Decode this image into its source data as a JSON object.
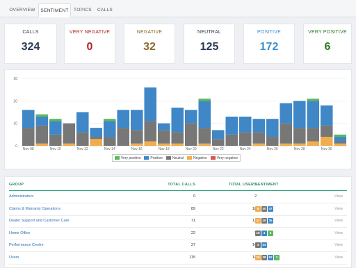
{
  "tabs": [
    {
      "label": "OVERVIEW"
    },
    {
      "label": "SENTIMENT"
    },
    {
      "label": "TOPICS"
    },
    {
      "label": "CALLS"
    }
  ],
  "cards": [
    {
      "label": "CALLS",
      "value": "324",
      "color": "#2b3b52"
    },
    {
      "label": "VERY NEGATIVE",
      "value": "0",
      "color": "#b3261e"
    },
    {
      "label": "NEGATIVE",
      "value": "32",
      "color": "#8a6d2a"
    },
    {
      "label": "NEUTRAL",
      "value": "125",
      "color": "#2b3b52"
    },
    {
      "label": "POSITIVE",
      "value": "172",
      "color": "#3d8fce"
    },
    {
      "label": "VERY POSITIVE",
      "value": "6",
      "color": "#2f7a23"
    }
  ],
  "colors": {
    "very_positive": "#5cb85c",
    "positive": "#3f87c6",
    "neutral": "#777777",
    "negative": "#f0ad4e",
    "very_negative": "#d9534f"
  },
  "chart_data": {
    "type": "bar",
    "stacked": true,
    "ylim": [
      0,
      30
    ],
    "yticks": [
      "0",
      "10",
      "20",
      "30"
    ],
    "categories": [
      "Nov 08",
      "Nov 09",
      "Nov 10",
      "Nov 11",
      "Nov 12",
      "Nov 13",
      "Nov 14",
      "Nov 15",
      "Nov 16",
      "Nov 17",
      "Nov 18",
      "Nov 19",
      "Nov 20",
      "Nov 21",
      "Nov 22",
      "Nov 23",
      "Nov 24",
      "Nov 25",
      "Nov 26",
      "Nov 27",
      "Nov 28",
      "Nov 29",
      "Nov 30",
      "Dec 01"
    ],
    "xtick_labels": [
      "Nov 08",
      "Nov 10",
      "Nov 12",
      "Nov 14",
      "Nov 16",
      "Nov 18",
      "Nov 20",
      "Nov 22",
      "Nov 24",
      "Nov 26",
      "Nov 28",
      "Nov 30"
    ],
    "series": [
      {
        "name": "Very negative",
        "values": [
          0,
          0,
          0,
          0,
          0,
          0,
          0,
          0,
          0,
          0,
          0,
          0,
          0,
          0,
          0,
          0,
          0,
          0,
          0,
          0,
          0,
          0,
          0,
          0
        ]
      },
      {
        "name": "Negative",
        "values": [
          0,
          1,
          0,
          1,
          0,
          3,
          0,
          0,
          1,
          2,
          1,
          1,
          0,
          1,
          0,
          0,
          0,
          1,
          0,
          1,
          1,
          2,
          4,
          1
        ]
      },
      {
        "name": "Neutral",
        "values": [
          8,
          8,
          5,
          9,
          6,
          1,
          4,
          8,
          6,
          9,
          6,
          5,
          10,
          7,
          3,
          5,
          6,
          5,
          4,
          9,
          7,
          6,
          5,
          1
        ]
      },
      {
        "name": "Positive",
        "values": [
          8,
          4,
          6,
          0,
          9,
          4,
          7,
          8,
          9,
          15,
          3,
          11,
          6,
          12,
          4,
          8,
          7,
          6,
          8,
          9,
          12,
          12,
          9,
          2
        ]
      },
      {
        "name": "Very positive",
        "values": [
          0,
          1,
          1,
          0,
          0,
          0,
          1,
          0,
          0,
          0,
          0,
          0,
          0,
          1,
          0,
          0,
          0,
          0,
          0,
          0,
          0,
          1,
          0,
          1
        ]
      }
    ],
    "legend": "bottom-center"
  },
  "table": {
    "headers": {
      "group": "GROUP",
      "calls": "TOTAL CALLS",
      "users": "TOTAL USERS",
      "sentiment": "SENTIMENT"
    },
    "view_label": "View",
    "rows": [
      {
        "group": "Administrators",
        "calls": "0",
        "users": "2",
        "sentiment": []
      },
      {
        "group": "Claims & Warranty Operations",
        "calls": "89",
        "users": "18",
        "sentiment": [
          {
            "value": "6",
            "type": "negative"
          },
          {
            "value": "40",
            "type": "neutral"
          },
          {
            "value": "47",
            "type": "positive"
          }
        ]
      },
      {
        "group": "Dealer Support and Customer Care",
        "calls": "71",
        "users": "13",
        "sentiment": [
          {
            "value": "11",
            "type": "negative"
          },
          {
            "value": "29",
            "type": "neutral"
          },
          {
            "value": "35",
            "type": "positive"
          }
        ]
      },
      {
        "group": "Home Office",
        "calls": "22",
        "users": "7",
        "sentiment": [
          {
            "value": "15",
            "type": "neutral"
          },
          {
            "value": "4",
            "type": "positive"
          },
          {
            "value": "5",
            "type": "very_positive"
          }
        ]
      },
      {
        "group": "Performance Centre",
        "calls": "27",
        "users": "14",
        "sentiment": [
          {
            "value": "3",
            "type": "neutral"
          },
          {
            "value": "24",
            "type": "positive"
          }
        ]
      },
      {
        "group": "Users",
        "calls": "115",
        "users": "14",
        "sentiment": [
          {
            "value": "15",
            "type": "negative"
          },
          {
            "value": "38",
            "type": "neutral"
          },
          {
            "value": "62",
            "type": "positive"
          },
          {
            "value": "3",
            "type": "very_positive"
          }
        ]
      }
    ]
  }
}
